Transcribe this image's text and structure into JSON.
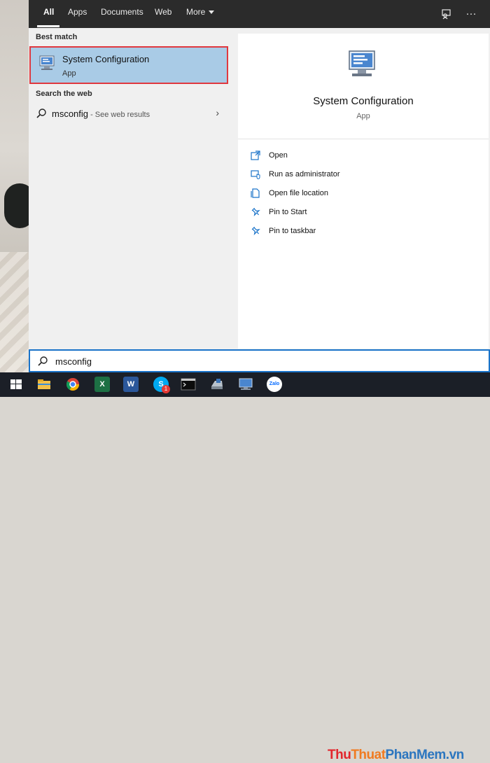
{
  "tabs": [
    {
      "label": "All",
      "active": true
    },
    {
      "label": "Apps"
    },
    {
      "label": "Documents"
    },
    {
      "label": "Web"
    },
    {
      "label": "More"
    }
  ],
  "top_icons": [
    "feedback-icon",
    "more-options-icon"
  ],
  "left": {
    "best_match_label": "Best match",
    "best_match": {
      "title": "System Configuration",
      "subtitle": "App",
      "icon": "system-configuration-icon"
    },
    "search_web_label": "Search the web",
    "web_result": {
      "query": "msconfig",
      "hint": " - See web results"
    }
  },
  "right": {
    "title": "System Configuration",
    "subtitle": "App",
    "actions": [
      {
        "label": "Open",
        "icon": "open-icon"
      },
      {
        "label": "Run as administrator",
        "icon": "run-as-admin-icon"
      },
      {
        "label": "Open file location",
        "icon": "file-location-icon"
      },
      {
        "label": "Pin to Start",
        "icon": "pin-icon"
      },
      {
        "label": "Pin to taskbar",
        "icon": "pin-icon"
      }
    ]
  },
  "search": {
    "value": "msconfig"
  },
  "taskbar": {
    "skype_badge": "1",
    "zalo_label": "Zalo",
    "word_label": "W",
    "excel_label": "X"
  },
  "watermark": {
    "part1": "Thu",
    "part2": "Thuat",
    "part3": "PhanMem",
    "part4": ".vn"
  },
  "colors": {
    "accent": "#1a73c9",
    "selection": "#a9cbe6",
    "highlight_border": "#e0383e",
    "topbar": "#2b2b2b"
  }
}
